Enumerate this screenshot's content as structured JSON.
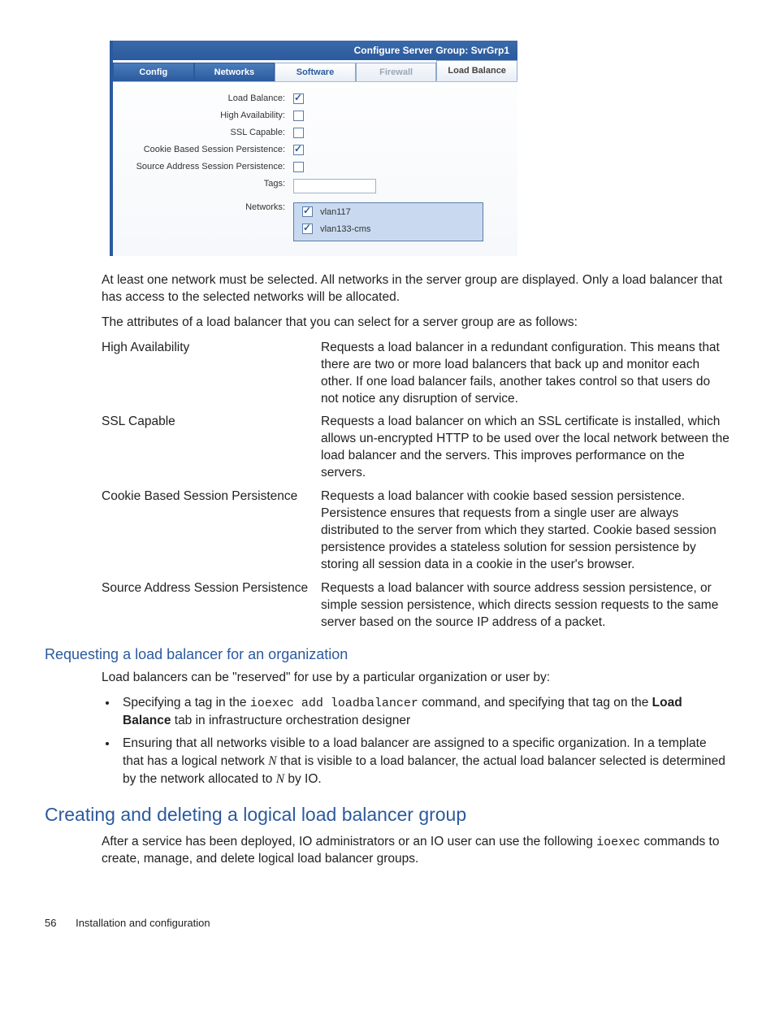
{
  "figure": {
    "title": "Configure Server Group: SvrGrp1",
    "tabs": {
      "config": "Config",
      "networks": "Networks",
      "software": "Software",
      "firewall": "Firewall",
      "loadbalance": "Load Balance"
    },
    "labels": {
      "loadBalance": "Load Balance:",
      "highAvailability": "High Availability:",
      "sslCapable": "SSL Capable:",
      "cookiePersistence": "Cookie Based Session Persistence:",
      "sourcePersistence": "Source Address Session Persistence:",
      "tags": "Tags:",
      "networks": "Networks:"
    },
    "networks": {
      "0": "vlan117",
      "1": "vlan133-cms"
    }
  },
  "body": {
    "p1": "At least one network must be selected. All networks in the server group are displayed. Only a load balancer that has access to the selected networks will be allocated.",
    "p2": "The attributes of a load balancer that you can select for a server group are as follows:",
    "defs": {
      "0": {
        "term": "High Availability",
        "desc": "Requests a load balancer in a redundant configuration. This means that there are two or more load balancers that back up and monitor each other. If one load balancer fails, another takes control so that users do not notice any disruption of service."
      },
      "1": {
        "term": "SSL Capable",
        "desc": "Requests a load balancer on which an SSL certificate is installed, which allows un-encrypted HTTP to be used over the local network between the load balancer and the servers. This improves performance on the servers."
      },
      "2": {
        "term": "Cookie Based Session Persistence",
        "desc": "Requests a load balancer with cookie based session persistence. Persistence ensures that requests from a single user are always distributed to the server from which they started. Cookie based session persistence provides a stateless solution for session persistence by storing all session data in a cookie in the user's browser."
      },
      "3": {
        "term": "Source Address Session Persistence",
        "desc": "Requests a load balancer with source address session persistence, or simple session persistence, which directs session requests to the same server based on the source IP address of a packet."
      }
    },
    "h3": "Requesting a load balancer for an organization",
    "p3": "Load balancers can be \"reserved\" for use by a particular organization or user by:",
    "bullets": {
      "0a": "Specifying a tag in the ",
      "0b": "ioexec add loadbalancer",
      "0c": " command, and specifying that tag on the ",
      "0d": "Load Balance",
      "0e": " tab in infrastructure orchestration designer",
      "1a": "Ensuring that all networks visible to a load balancer are assigned to a specific organization. In a template that has a logical network ",
      "1b": "N",
      "1c": " that is visible to a load balancer, the actual load balancer selected is determined by the network allocated to ",
      "1d": "N",
      "1e": " by IO."
    },
    "h2": "Creating and deleting a logical load balancer group",
    "p4a": "After a service has been deployed, IO administrators or an IO user can use the following ",
    "p4b": "ioexec",
    "p4c": " commands to create, manage, and delete logical load balancer groups."
  },
  "footer": {
    "page": "56",
    "section": "Installation and configuration"
  }
}
